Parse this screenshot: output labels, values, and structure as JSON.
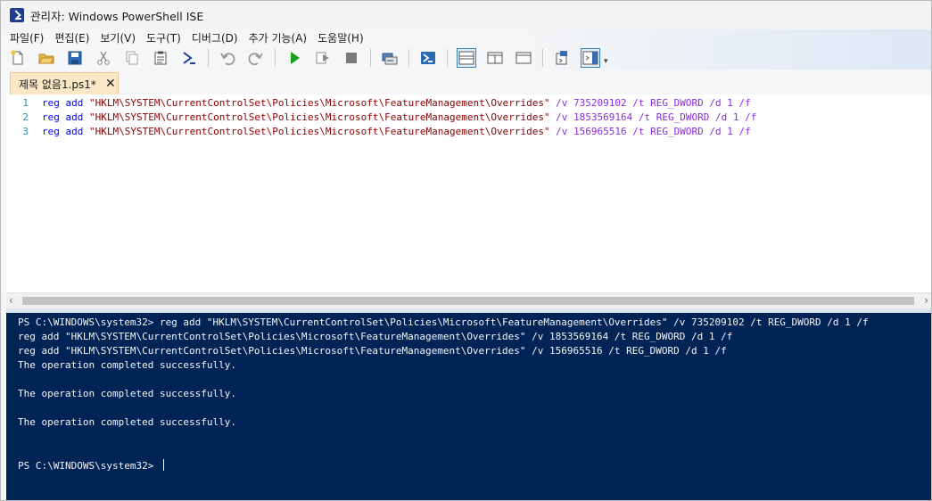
{
  "window": {
    "title": "관리자: Windows PowerShell ISE"
  },
  "menu": [
    "파일(F)",
    "편집(E)",
    "보기(V)",
    "도구(T)",
    "디버그(D)",
    "추가 기능(A)",
    "도움말(H)"
  ],
  "toolbar": {
    "icons": [
      "new-file-icon",
      "open-folder-icon",
      "save-icon",
      "cut-icon",
      "copy-icon",
      "paste-icon",
      "console-prompt-icon",
      "undo-icon",
      "redo-icon",
      "run-script-icon",
      "run-selection-icon",
      "stop-icon",
      "remote-powershell-icon",
      "powershell-icon",
      "layout-top-icon",
      "layout-right-icon",
      "layout-max-icon",
      "show-script-icon",
      "show-commands-icon"
    ],
    "overflow": "▾"
  },
  "tab": {
    "label": "제목 없음1.ps1*",
    "close": "✕"
  },
  "editor": {
    "lines": [
      {
        "num": "1",
        "cmd": "reg",
        "sub": " add ",
        "path": "\"HKLM\\SYSTEM\\CurrentControlSet\\Policies\\Microsoft\\FeatureManagement\\Overrides\"",
        "rest": " /v 735209102 /t REG_DWORD /d 1 /f"
      },
      {
        "num": "2",
        "cmd": "reg",
        "sub": " add ",
        "path": "\"HKLM\\SYSTEM\\CurrentControlSet\\Policies\\Microsoft\\FeatureManagement\\Overrides\"",
        "rest": " /v 1853569164 /t REG_DWORD /d 1 /f"
      },
      {
        "num": "3",
        "cmd": "reg",
        "sub": " add ",
        "path": "\"HKLM\\SYSTEM\\CurrentControlSet\\Policies\\Microsoft\\FeatureManagement\\Overrides\"",
        "rest": " /v 156965516 /t REG_DWORD /d 1 /f"
      }
    ]
  },
  "scrollbar": {
    "left": "‹",
    "right": "›"
  },
  "console": {
    "lines": [
      "PS C:\\WINDOWS\\system32> reg add \"HKLM\\SYSTEM\\CurrentControlSet\\Policies\\Microsoft\\FeatureManagement\\Overrides\" /v 735209102 /t REG_DWORD /d 1 /f",
      "reg add \"HKLM\\SYSTEM\\CurrentControlSet\\Policies\\Microsoft\\FeatureManagement\\Overrides\" /v 1853569164 /t REG_DWORD /d 1 /f",
      "reg add \"HKLM\\SYSTEM\\CurrentControlSet\\Policies\\Microsoft\\FeatureManagement\\Overrides\" /v 156965516 /t REG_DWORD /d 1 /f",
      "The operation completed successfully.",
      "",
      "The operation completed successfully.",
      "",
      "The operation completed successfully.",
      "",
      "",
      "PS C:\\WINDOWS\\system32> "
    ]
  },
  "colors": {
    "console_bg": "#012456",
    "tab_bg": "#fbe7c6",
    "keyword": "#0000ff",
    "string": "#8b0000",
    "param": "#8a2be2"
  }
}
